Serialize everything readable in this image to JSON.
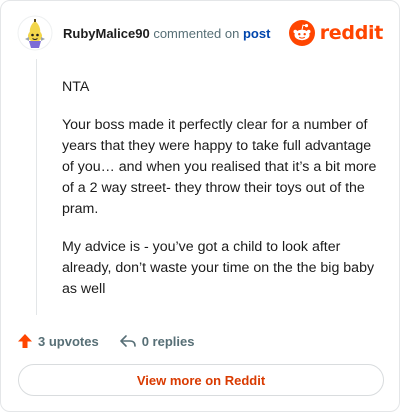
{
  "header": {
    "username": "RubyMalice90",
    "action_text": "commented on",
    "post_link": "post",
    "brand": "reddit"
  },
  "comment": {
    "paragraphs": [
      "NTA",
      "Your boss made it perfectly clear for a number of years that they were happy to take full advantage of you… and when you realised that it’s a bit more of a 2 way street- they throw their toys out of the pram.",
      "My advice is - you’ve got a child to look after already, don’t waste your time on the the big baby as well"
    ]
  },
  "actions": {
    "upvotes": "3 upvotes",
    "replies": "0 replies"
  },
  "cta": {
    "label": "View more on Reddit"
  },
  "colors": {
    "brand_orange": "#ff4500",
    "link_blue": "#0045ac",
    "cta_text": "#d93a00"
  }
}
